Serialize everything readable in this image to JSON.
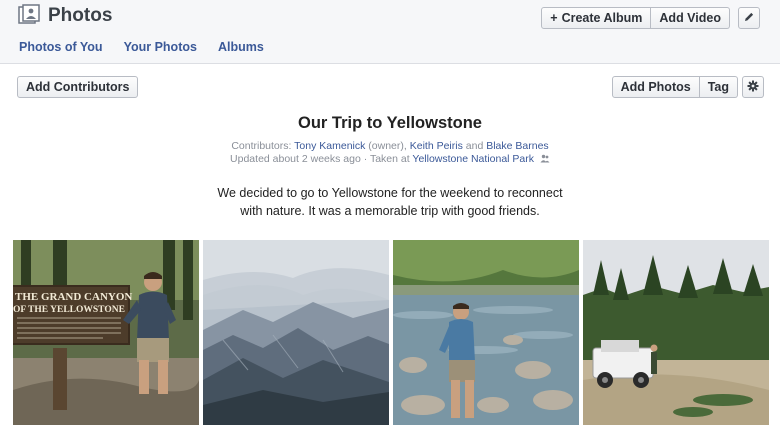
{
  "header": {
    "title": "Photos",
    "create_album": "Create Album",
    "add_video": "Add Video",
    "icons": [
      "photos-icon",
      "plus-icon",
      "pencil-icon"
    ]
  },
  "tabs": [
    {
      "label": "Photos of You"
    },
    {
      "label": "Your Photos"
    },
    {
      "label": "Albums"
    }
  ],
  "toolbar": {
    "add_contributors": "Add Contributors",
    "add_photos": "Add Photos",
    "tag": "Tag",
    "icons": [
      "gear-icon"
    ]
  },
  "album": {
    "title": "Our Trip to Yellowstone",
    "contributors_prefix": "Contributors:",
    "owner": "Tony Kamenick",
    "owner_note": "(owner),",
    "contributor2": "Keith Peiris",
    "and": "and",
    "contributor3": "Blake Barnes",
    "updated": "Updated about 2 weeks ago",
    "sep": "·",
    "taken_at": "Taken at",
    "location": "Yellowstone National Park",
    "line1": "We decided to go to Yellowstone for the weekend to reconnect",
    "line2": "with nature. It was a memorable trip with good friends."
  },
  "photos": [
    {
      "sign_line1": "THE GRAND CANYON",
      "sign_line2": "OF THE YELLOWSTONE"
    },
    {},
    {},
    {}
  ],
  "colors": {
    "link": "#3b5998",
    "header_bg": "#f6f7f9"
  }
}
